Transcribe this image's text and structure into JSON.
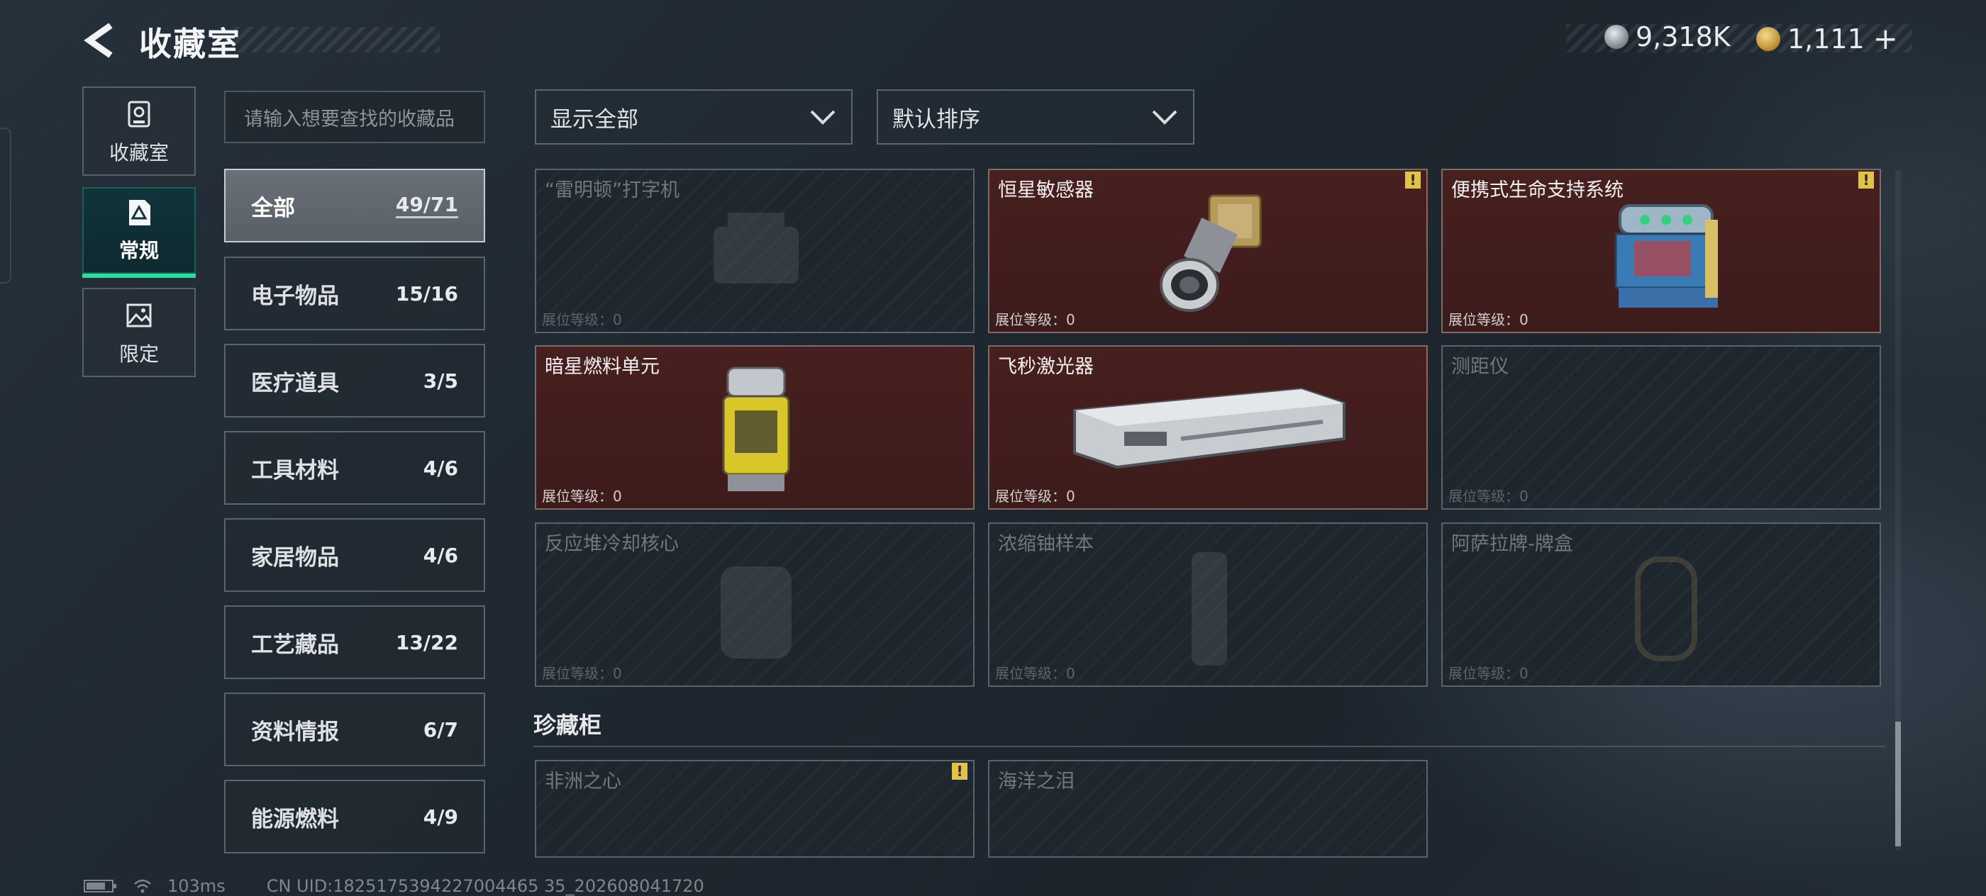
{
  "header": {
    "title": "收藏室",
    "currency_primary": "9,318K",
    "currency_secondary": "1,111",
    "plus": "+"
  },
  "left_tabs": [
    {
      "label": "收藏室",
      "icon": "trophy-icon"
    },
    {
      "label": "常规",
      "icon": "document-icon"
    },
    {
      "label": "限定",
      "icon": "picture-icon"
    }
  ],
  "search": {
    "placeholder": "请输入想要查找的收藏品"
  },
  "categories": [
    {
      "label": "全部",
      "count": "49/71"
    },
    {
      "label": "电子物品",
      "count": "15/16"
    },
    {
      "label": "医疗道具",
      "count": "3/5"
    },
    {
      "label": "工具材料",
      "count": "4/6"
    },
    {
      "label": "家居物品",
      "count": "4/6"
    },
    {
      "label": "工艺藏品",
      "count": "13/22"
    },
    {
      "label": "资料情报",
      "count": "6/7"
    },
    {
      "label": "能源燃料",
      "count": "4/9"
    }
  ],
  "filters": {
    "display": "显示全部",
    "sort": "默认排序"
  },
  "level_label": "展位等级：0",
  "items": [
    {
      "name": "“雷明顿”打字机",
      "owned": false,
      "badge": false
    },
    {
      "name": "恒星敏感器",
      "owned": true,
      "badge": true
    },
    {
      "name": "便携式生命支持系统",
      "owned": true,
      "badge": true
    },
    {
      "name": "暗星燃料单元",
      "owned": true,
      "badge": false
    },
    {
      "name": "飞秒激光器",
      "owned": true,
      "badge": false
    },
    {
      "name": "测距仪",
      "owned": false,
      "badge": false
    },
    {
      "name": "反应堆冷却核心",
      "owned": false,
      "badge": false
    },
    {
      "name": "浓缩铀样本",
      "owned": false,
      "badge": false
    },
    {
      "name": "阿萨拉牌-牌盒",
      "owned": false,
      "badge": false
    }
  ],
  "showcase": {
    "title": "珍藏柜",
    "items": [
      {
        "name": "非洲之心",
        "badge": true
      },
      {
        "name": "海洋之泪",
        "badge": false
      }
    ]
  },
  "badge_symbol": "!",
  "footer": {
    "ping": "103ms",
    "uid": "CN UID:1825175394227004465 35_202608041720"
  },
  "colors": {
    "owned_bg": "#47201f",
    "accent_green": "#2fdc9a",
    "badge_yellow": "#e3c24a"
  }
}
